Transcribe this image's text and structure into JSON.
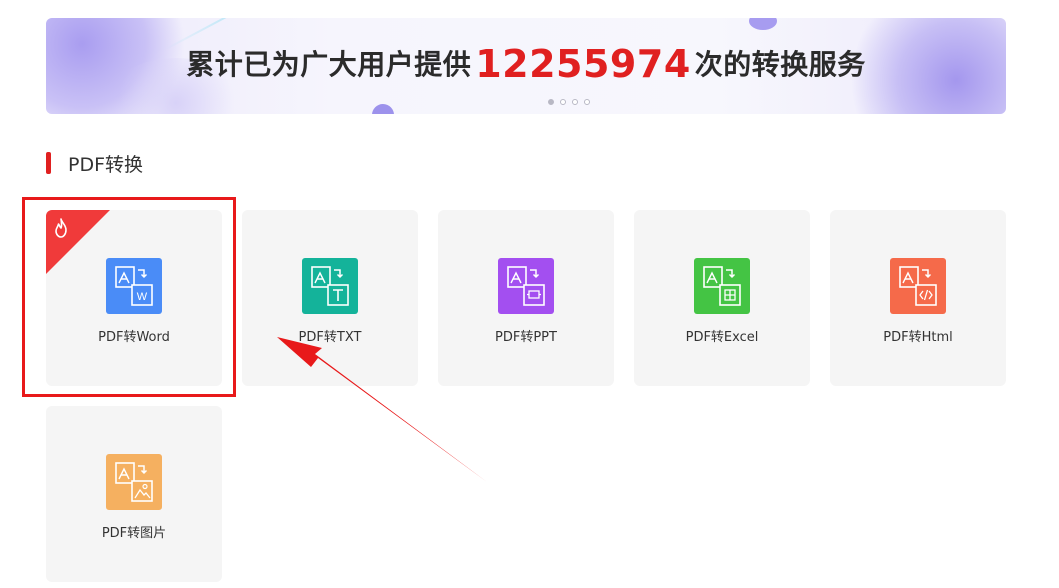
{
  "banner": {
    "prefix": "累计已为广大用户提供",
    "count": "12255974",
    "suffix": "次的转换服务",
    "slides": 4,
    "active_slide": 1
  },
  "section": {
    "title": "PDF转换",
    "accent_color": "#e02020"
  },
  "tools": [
    {
      "label": "PDF转Word",
      "icon": "pdf-to-word-icon",
      "color": "#4a8cf7",
      "hot": true
    },
    {
      "label": "PDF转TXT",
      "icon": "pdf-to-txt-icon",
      "color": "#14b39a",
      "hot": false
    },
    {
      "label": "PDF转PPT",
      "icon": "pdf-to-ppt-icon",
      "color": "#a34ff0",
      "hot": false
    },
    {
      "label": "PDF转Excel",
      "icon": "pdf-to-excel-icon",
      "color": "#44c444",
      "hot": false
    },
    {
      "label": "PDF转Html",
      "icon": "pdf-to-html-icon",
      "color": "#f56a4a",
      "hot": false
    },
    {
      "label": "PDF转图片",
      "icon": "pdf-to-image-icon",
      "color": "#f5b060",
      "hot": false
    }
  ],
  "annotation": {
    "highlight_color": "#e8191a"
  }
}
